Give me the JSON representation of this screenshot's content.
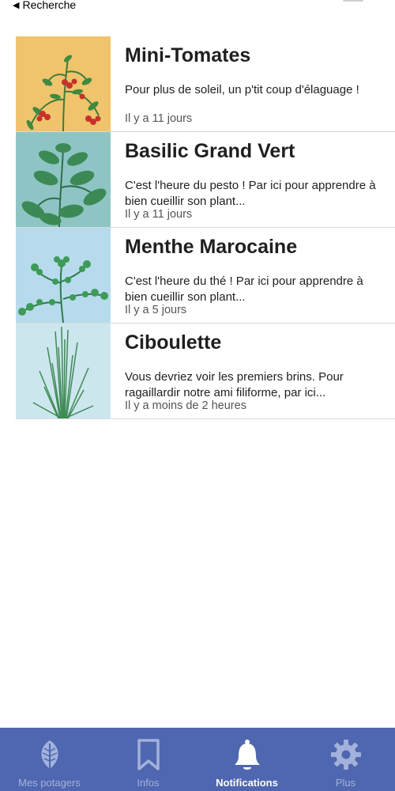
{
  "status": {
    "back_label": "Recherche"
  },
  "notifications": [
    {
      "title": "Mini-Tomates",
      "message": "Pour plus de soleil, un p'tit coup d'élaguage !",
      "time": "Il y a 11 jours",
      "bg": "#f0c46c"
    },
    {
      "title": "Basilic Grand Vert",
      "message": "C'est l'heure du pesto ! Par ici pour apprendre à bien cueillir son plant...",
      "time": "Il y a 11 jours",
      "bg": "#8ec5c4"
    },
    {
      "title": "Menthe Marocaine",
      "message": "C'est l'heure du thé ! Par ici pour apprendre à bien cueillir son plant...",
      "time": "Il y a 5 jours",
      "bg": "#b7dbec"
    },
    {
      "title": "Ciboulette",
      "message": "Vous devriez voir les premiers brins. Pour ragaillardir notre ami filiforme, par ici...",
      "time": "Il y a moins de 2 heures",
      "bg": "#cce6ee"
    }
  ],
  "tabbar": {
    "bg": "#4f67b0",
    "tabs": [
      {
        "label": "Mes potagers",
        "icon": "leaf-icon",
        "active": false
      },
      {
        "label": "Infos",
        "icon": "bookmark-icon",
        "active": false
      },
      {
        "label": "Notifications",
        "icon": "bell-icon",
        "active": true
      },
      {
        "label": "Plus",
        "icon": "gear-icon",
        "active": false
      }
    ]
  }
}
